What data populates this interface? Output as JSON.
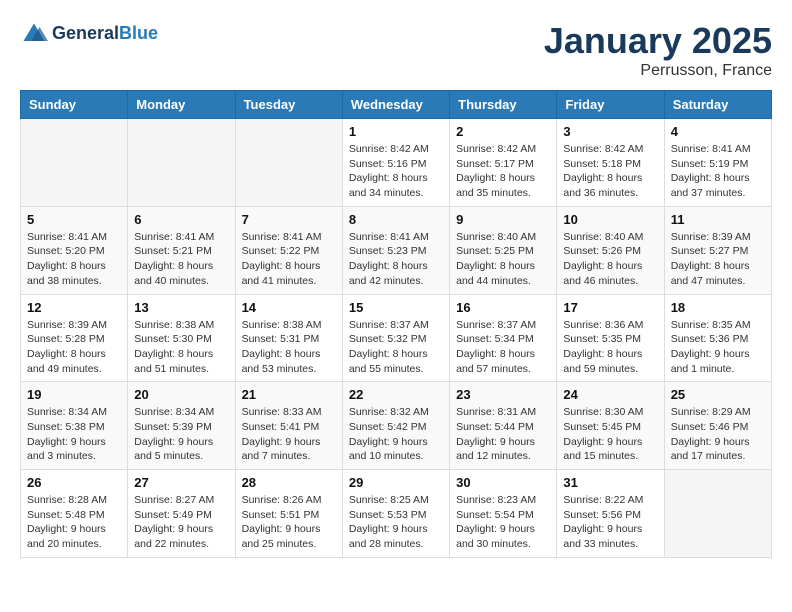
{
  "header": {
    "logo_line1": "General",
    "logo_line2": "Blue",
    "month_title": "January 2025",
    "location": "Perrusson, France"
  },
  "weekdays": [
    "Sunday",
    "Monday",
    "Tuesday",
    "Wednesday",
    "Thursday",
    "Friday",
    "Saturday"
  ],
  "weeks": [
    [
      {
        "day": "",
        "sunrise": "",
        "sunset": "",
        "daylight": ""
      },
      {
        "day": "",
        "sunrise": "",
        "sunset": "",
        "daylight": ""
      },
      {
        "day": "",
        "sunrise": "",
        "sunset": "",
        "daylight": ""
      },
      {
        "day": "1",
        "sunrise": "Sunrise: 8:42 AM",
        "sunset": "Sunset: 5:16 PM",
        "daylight": "Daylight: 8 hours and 34 minutes."
      },
      {
        "day": "2",
        "sunrise": "Sunrise: 8:42 AM",
        "sunset": "Sunset: 5:17 PM",
        "daylight": "Daylight: 8 hours and 35 minutes."
      },
      {
        "day": "3",
        "sunrise": "Sunrise: 8:42 AM",
        "sunset": "Sunset: 5:18 PM",
        "daylight": "Daylight: 8 hours and 36 minutes."
      },
      {
        "day": "4",
        "sunrise": "Sunrise: 8:41 AM",
        "sunset": "Sunset: 5:19 PM",
        "daylight": "Daylight: 8 hours and 37 minutes."
      }
    ],
    [
      {
        "day": "5",
        "sunrise": "Sunrise: 8:41 AM",
        "sunset": "Sunset: 5:20 PM",
        "daylight": "Daylight: 8 hours and 38 minutes."
      },
      {
        "day": "6",
        "sunrise": "Sunrise: 8:41 AM",
        "sunset": "Sunset: 5:21 PM",
        "daylight": "Daylight: 8 hours and 40 minutes."
      },
      {
        "day": "7",
        "sunrise": "Sunrise: 8:41 AM",
        "sunset": "Sunset: 5:22 PM",
        "daylight": "Daylight: 8 hours and 41 minutes."
      },
      {
        "day": "8",
        "sunrise": "Sunrise: 8:41 AM",
        "sunset": "Sunset: 5:23 PM",
        "daylight": "Daylight: 8 hours and 42 minutes."
      },
      {
        "day": "9",
        "sunrise": "Sunrise: 8:40 AM",
        "sunset": "Sunset: 5:25 PM",
        "daylight": "Daylight: 8 hours and 44 minutes."
      },
      {
        "day": "10",
        "sunrise": "Sunrise: 8:40 AM",
        "sunset": "Sunset: 5:26 PM",
        "daylight": "Daylight: 8 hours and 46 minutes."
      },
      {
        "day": "11",
        "sunrise": "Sunrise: 8:39 AM",
        "sunset": "Sunset: 5:27 PM",
        "daylight": "Daylight: 8 hours and 47 minutes."
      }
    ],
    [
      {
        "day": "12",
        "sunrise": "Sunrise: 8:39 AM",
        "sunset": "Sunset: 5:28 PM",
        "daylight": "Daylight: 8 hours and 49 minutes."
      },
      {
        "day": "13",
        "sunrise": "Sunrise: 8:38 AM",
        "sunset": "Sunset: 5:30 PM",
        "daylight": "Daylight: 8 hours and 51 minutes."
      },
      {
        "day": "14",
        "sunrise": "Sunrise: 8:38 AM",
        "sunset": "Sunset: 5:31 PM",
        "daylight": "Daylight: 8 hours and 53 minutes."
      },
      {
        "day": "15",
        "sunrise": "Sunrise: 8:37 AM",
        "sunset": "Sunset: 5:32 PM",
        "daylight": "Daylight: 8 hours and 55 minutes."
      },
      {
        "day": "16",
        "sunrise": "Sunrise: 8:37 AM",
        "sunset": "Sunset: 5:34 PM",
        "daylight": "Daylight: 8 hours and 57 minutes."
      },
      {
        "day": "17",
        "sunrise": "Sunrise: 8:36 AM",
        "sunset": "Sunset: 5:35 PM",
        "daylight": "Daylight: 8 hours and 59 minutes."
      },
      {
        "day": "18",
        "sunrise": "Sunrise: 8:35 AM",
        "sunset": "Sunset: 5:36 PM",
        "daylight": "Daylight: 9 hours and 1 minute."
      }
    ],
    [
      {
        "day": "19",
        "sunrise": "Sunrise: 8:34 AM",
        "sunset": "Sunset: 5:38 PM",
        "daylight": "Daylight: 9 hours and 3 minutes."
      },
      {
        "day": "20",
        "sunrise": "Sunrise: 8:34 AM",
        "sunset": "Sunset: 5:39 PM",
        "daylight": "Daylight: 9 hours and 5 minutes."
      },
      {
        "day": "21",
        "sunrise": "Sunrise: 8:33 AM",
        "sunset": "Sunset: 5:41 PM",
        "daylight": "Daylight: 9 hours and 7 minutes."
      },
      {
        "day": "22",
        "sunrise": "Sunrise: 8:32 AM",
        "sunset": "Sunset: 5:42 PM",
        "daylight": "Daylight: 9 hours and 10 minutes."
      },
      {
        "day": "23",
        "sunrise": "Sunrise: 8:31 AM",
        "sunset": "Sunset: 5:44 PM",
        "daylight": "Daylight: 9 hours and 12 minutes."
      },
      {
        "day": "24",
        "sunrise": "Sunrise: 8:30 AM",
        "sunset": "Sunset: 5:45 PM",
        "daylight": "Daylight: 9 hours and 15 minutes."
      },
      {
        "day": "25",
        "sunrise": "Sunrise: 8:29 AM",
        "sunset": "Sunset: 5:46 PM",
        "daylight": "Daylight: 9 hours and 17 minutes."
      }
    ],
    [
      {
        "day": "26",
        "sunrise": "Sunrise: 8:28 AM",
        "sunset": "Sunset: 5:48 PM",
        "daylight": "Daylight: 9 hours and 20 minutes."
      },
      {
        "day": "27",
        "sunrise": "Sunrise: 8:27 AM",
        "sunset": "Sunset: 5:49 PM",
        "daylight": "Daylight: 9 hours and 22 minutes."
      },
      {
        "day": "28",
        "sunrise": "Sunrise: 8:26 AM",
        "sunset": "Sunset: 5:51 PM",
        "daylight": "Daylight: 9 hours and 25 minutes."
      },
      {
        "day": "29",
        "sunrise": "Sunrise: 8:25 AM",
        "sunset": "Sunset: 5:53 PM",
        "daylight": "Daylight: 9 hours and 28 minutes."
      },
      {
        "day": "30",
        "sunrise": "Sunrise: 8:23 AM",
        "sunset": "Sunset: 5:54 PM",
        "daylight": "Daylight: 9 hours and 30 minutes."
      },
      {
        "day": "31",
        "sunrise": "Sunrise: 8:22 AM",
        "sunset": "Sunset: 5:56 PM",
        "daylight": "Daylight: 9 hours and 33 minutes."
      },
      {
        "day": "",
        "sunrise": "",
        "sunset": "",
        "daylight": ""
      }
    ]
  ]
}
